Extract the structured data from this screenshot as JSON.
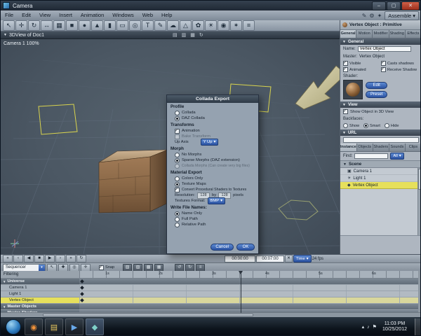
{
  "window": {
    "title": "Camera"
  },
  "icons": {
    "min": "–",
    "max": "▢",
    "close": "✕",
    "dropdown": "▾",
    "collapse": "▼",
    "tree_camera": "▣",
    "tree_light": "☀",
    "tree_object": "◆",
    "close_small": "✕"
  },
  "menubar": {
    "items": [
      "File",
      "Edit",
      "View",
      "Insert",
      "Animation",
      "Windows",
      "Web",
      "Help"
    ],
    "right_icons": [
      "✎",
      "⚙",
      "✦"
    ],
    "mode": "Assemble"
  },
  "toolbar": {
    "icons": [
      "↖",
      "✛",
      "↻",
      "↔",
      "▦",
      "■",
      "●",
      "▲",
      "▮",
      "▭",
      "◎",
      "T",
      "✎",
      "☁",
      "△",
      "✿",
      "☀",
      "◉",
      "✶",
      "≡"
    ]
  },
  "viewport": {
    "title": "3DView of Doc1",
    "camera": "Camera 1 100%",
    "header_icons": [
      "▤",
      "▥",
      "▦",
      "↻"
    ]
  },
  "dialog": {
    "title": "Collada Export",
    "profile_label": "Profile",
    "opt_collada": "Collada",
    "opt_daz": "DAZ Collada",
    "transforms_label": "Transforms",
    "cb_animation": "Animation",
    "cb_bake": "Bake Transform",
    "up_axis_label": "Up Axis",
    "up_axis_value": "Y Up",
    "morph_label": "Morph",
    "opt_no_morphs": "No Morphs",
    "opt_sparse": "Sparse Morphs (DAZ extension)",
    "opt_collada_morphs": "Collada Morphs (Can create very big files)",
    "material_label": "Material Export",
    "opt_colors": "Colors Only",
    "opt_textures": "Texture Maps",
    "cb_convert": "Convert Procedural Shaders to Textures",
    "resolution_label": "Resolution:",
    "res_w": "128",
    "by_label": "by",
    "res_h": "128",
    "pixels_label": "pixels",
    "format_label": "Textures Format:",
    "format_value": "BMP",
    "write_label": "Write File Names:",
    "opt_name_only": "Name Only",
    "opt_full_path": "Full Path",
    "opt_relative": "Relative Path",
    "cancel": "Cancel",
    "ok": "OK"
  },
  "props": {
    "header": "Vertex Object : Primitive",
    "tabs": [
      "General",
      "Motion",
      "Modifier",
      "Shading",
      "Effects"
    ],
    "sec_general": "General",
    "name_label": "Name:",
    "name_value": "Vertex Object",
    "master_label": "Master:",
    "master_value": "Vertex Object",
    "cb_visible": "Visible",
    "cb_animated": "Animated",
    "cb_casts": "Casts shadows",
    "cb_receive": "Receive Shadow",
    "shader_label": "Shader:",
    "btn_edit": "Edit",
    "btn_preset": "Preset",
    "sec_view": "View",
    "cb_show_object": "Show Object in 3D View",
    "backfaces_label": "Backfaces:",
    "bf_show": "Show",
    "bf_smart": "Smart",
    "bf_hide": "Hide",
    "sec_url": "URL",
    "tabs2": [
      "Instance",
      "Objects",
      "Shaders",
      "Sounds",
      "Clips"
    ],
    "find_label": "Find:",
    "find_filter": "All",
    "scene_label": "Scene",
    "tree": [
      "Camera 1",
      "Light 1",
      "Vertex Object"
    ]
  },
  "timeline": {
    "transport": [
      "«",
      "‹",
      "◀",
      "■",
      "▶",
      "›",
      "»",
      "↻"
    ],
    "time_current": "00:00:00",
    "time_end": "00:07:00",
    "time_mode": "Time",
    "fps": "24 fps",
    "sequencer": "Sequencer",
    "row2_icons_a": [
      "↖",
      "✚",
      "◎",
      "✛"
    ],
    "snap_label": "Snap",
    "row2_icons_b": [
      "▧",
      "▨",
      "▩",
      "▦"
    ],
    "row2_icons_c": [
      "↺",
      "↻",
      "≡"
    ],
    "filtering_label": "Filtering",
    "ruler": [
      "1s",
      "2s",
      "3s",
      "4s",
      "5s",
      "6s"
    ],
    "tracks": [
      {
        "name": "Universe"
      },
      {
        "name": "Camera 1"
      },
      {
        "name": "Light 1"
      },
      {
        "name": "Vertex Object"
      },
      {
        "name": "Master Objects"
      },
      {
        "name": "Master Shaders"
      }
    ]
  },
  "taskbar": {
    "apps": [
      "◉",
      "▤",
      "▶",
      "◆"
    ],
    "tray_icons": [
      "▴",
      "♪",
      "⚑"
    ],
    "time": "11:03 PM",
    "date": "10/25/2012"
  }
}
